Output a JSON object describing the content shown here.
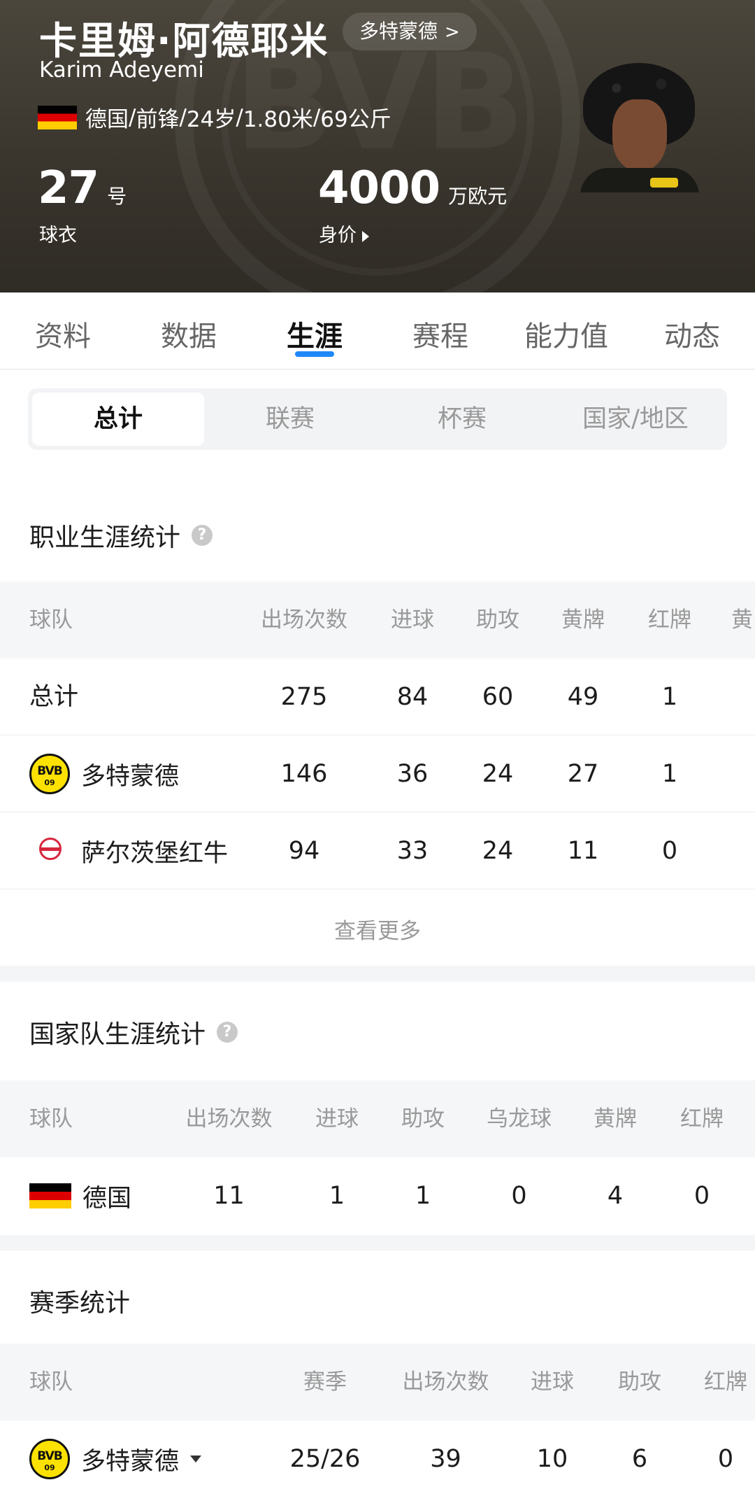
{
  "header": {
    "name_cn": "卡里姆·阿德耶米",
    "name_en": "Karim Adeyemi",
    "club_chip": "多特蒙德",
    "club_chip_chevron": ">",
    "info": {
      "country": "德国",
      "position": "前锋",
      "age": "24岁",
      "height": "1.80米",
      "weight": "69公斤",
      "separator": " / "
    },
    "shirt": {
      "number": "27",
      "unit": "号",
      "caption": "球衣"
    },
    "value": {
      "number": "4000",
      "unit": "万欧元",
      "caption": "身价"
    }
  },
  "tabs": [
    "资料",
    "数据",
    "生涯",
    "赛程",
    "能力值",
    "动态"
  ],
  "active_tab": "生涯",
  "segments": [
    "总计",
    "联赛",
    "杯赛",
    "国家/地区"
  ],
  "active_segment": "总计",
  "career": {
    "title": "职业生涯统计",
    "help": "?",
    "columns": [
      "球队",
      "出场次数",
      "进球",
      "助攻",
      "黄牌",
      "红牌",
      "黄"
    ],
    "rows": [
      {
        "team": "总计",
        "apps": "275",
        "goals": "84",
        "assists": "60",
        "yellow": "49",
        "red": "1"
      },
      {
        "team": "多特蒙德",
        "logo": "bvb-logo",
        "apps": "146",
        "goals": "36",
        "assists": "24",
        "yellow": "27",
        "red": "1"
      },
      {
        "team": "萨尔茨堡红牛",
        "logo": "red-bull-salzburg-logo",
        "apps": "94",
        "goals": "33",
        "assists": "24",
        "yellow": "11",
        "red": "0"
      }
    ],
    "more": "查看更多"
  },
  "national": {
    "title": "国家队生涯统计",
    "help": "?",
    "columns": [
      "球队",
      "出场次数",
      "进球",
      "助攻",
      "乌龙球",
      "黄牌",
      "红牌"
    ],
    "rows": [
      {
        "team": "德国",
        "logo": "germany-flag",
        "apps": "11",
        "goals": "1",
        "assists": "1",
        "own_goals": "0",
        "yellow": "4",
        "red": "0"
      }
    ]
  },
  "season": {
    "title": "赛季统计",
    "columns": [
      "球队",
      "赛季",
      "出场次数",
      "进球",
      "助攻",
      "红牌"
    ],
    "rows": [
      {
        "team": "多特蒙德",
        "logo": "bvb-logo",
        "season": "25/26",
        "apps": "39",
        "goals": "10",
        "assists": "6",
        "red": "0"
      }
    ]
  },
  "colors": {
    "accent": "#1e88f7",
    "header_bg": "#3f3b33",
    "muted": "#999999"
  }
}
